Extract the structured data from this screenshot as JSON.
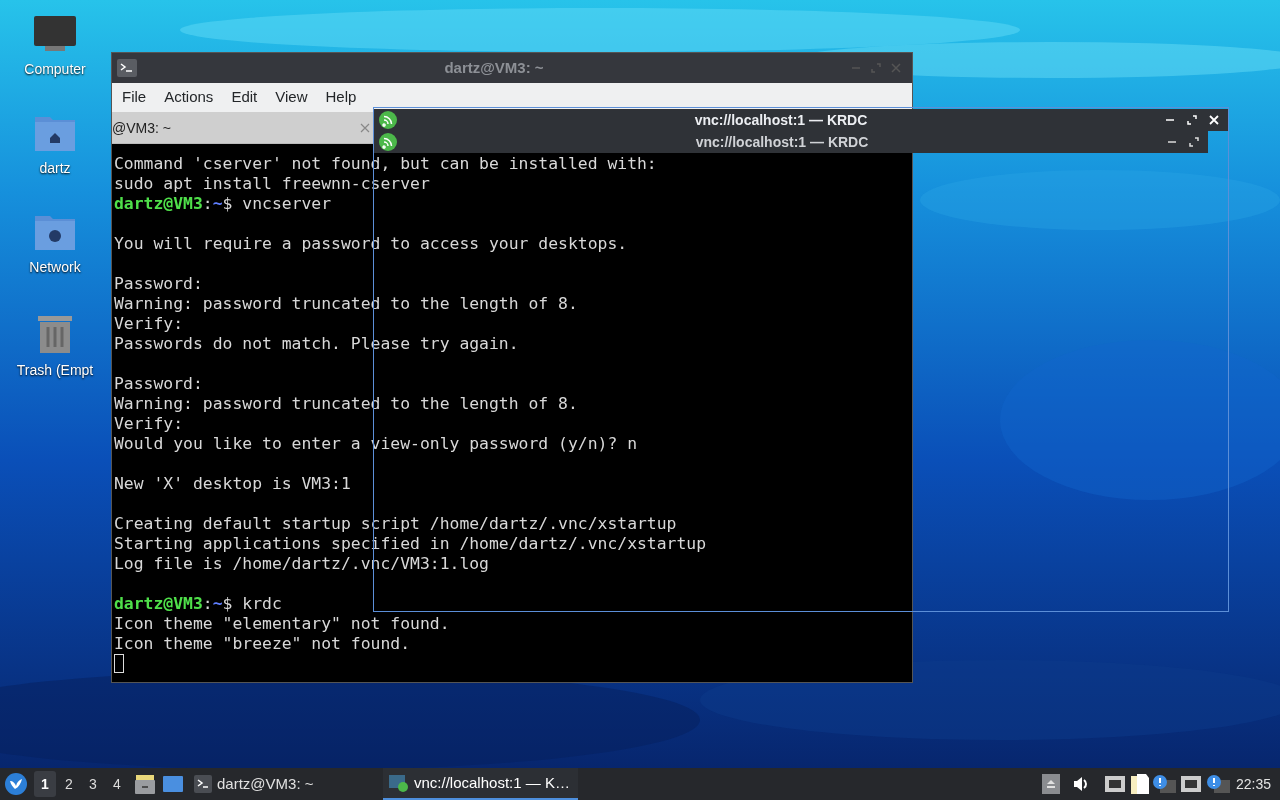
{
  "desktop_icons": [
    {
      "label": "Computer",
      "kind": "computer"
    },
    {
      "label": "dartz",
      "kind": "home"
    },
    {
      "label": "Network",
      "kind": "network"
    },
    {
      "label": "Trash (Empt",
      "kind": "trash"
    }
  ],
  "terminal": {
    "title": "dartz@VM3: ~",
    "menu": [
      "File",
      "Actions",
      "Edit",
      "View",
      "Help"
    ],
    "tab": "@VM3: ~",
    "lines": [
      {
        "kind": "output",
        "text": "Command 'cserver' not found, but can be installed with:"
      },
      {
        "kind": "output",
        "text": "sudo apt install freewnn-cserver"
      },
      {
        "kind": "prompt",
        "user": "dartz@VM3",
        "separator": ":",
        "path": "~",
        "command": "$ vncserver"
      },
      {
        "kind": "blank"
      },
      {
        "kind": "output",
        "text": "You will require a password to access your desktops."
      },
      {
        "kind": "blank"
      },
      {
        "kind": "output",
        "text": "Password:"
      },
      {
        "kind": "output",
        "text": "Warning: password truncated to the length of 8."
      },
      {
        "kind": "output",
        "text": "Verify:"
      },
      {
        "kind": "output",
        "text": "Passwords do not match. Please try again."
      },
      {
        "kind": "blank"
      },
      {
        "kind": "output",
        "text": "Password:"
      },
      {
        "kind": "output",
        "text": "Warning: password truncated to the length of 8."
      },
      {
        "kind": "output",
        "text": "Verify:"
      },
      {
        "kind": "output",
        "text": "Would you like to enter a view-only password (y/n)? n"
      },
      {
        "kind": "blank"
      },
      {
        "kind": "output",
        "text": "New 'X' desktop is VM3:1"
      },
      {
        "kind": "blank"
      },
      {
        "kind": "output",
        "text": "Creating default startup script /home/dartz/.vnc/xstartup"
      },
      {
        "kind": "output",
        "text": "Starting applications specified in /home/dartz/.vnc/xstartup"
      },
      {
        "kind": "output",
        "text": "Log file is /home/dartz/.vnc/VM3:1.log"
      },
      {
        "kind": "blank"
      },
      {
        "kind": "prompt",
        "user": "dartz@VM3",
        "separator": ":",
        "path": "~",
        "command": "$ krdc"
      },
      {
        "kind": "output",
        "text": "Icon theme \"elementary\" not found."
      },
      {
        "kind": "output",
        "text": "Icon theme \"breeze\" not found."
      },
      {
        "kind": "cursor"
      }
    ]
  },
  "krdc": {
    "title": "vnc://localhost:1 — KRDC",
    "ghost_title": "vnc://localhost:1 — KRDC"
  },
  "taskbar": {
    "workspaces": [
      {
        "label": "1",
        "selected": true
      },
      {
        "label": "2",
        "selected": false
      },
      {
        "label": "3",
        "selected": false
      },
      {
        "label": "4",
        "selected": false
      }
    ],
    "tasks": [
      {
        "label": "dartz@VM3: ~",
        "kind": "terminal",
        "selected": false
      },
      {
        "label": "vnc://localhost:1 — K…",
        "kind": "remote",
        "selected": true
      }
    ],
    "clock": "22:35"
  }
}
